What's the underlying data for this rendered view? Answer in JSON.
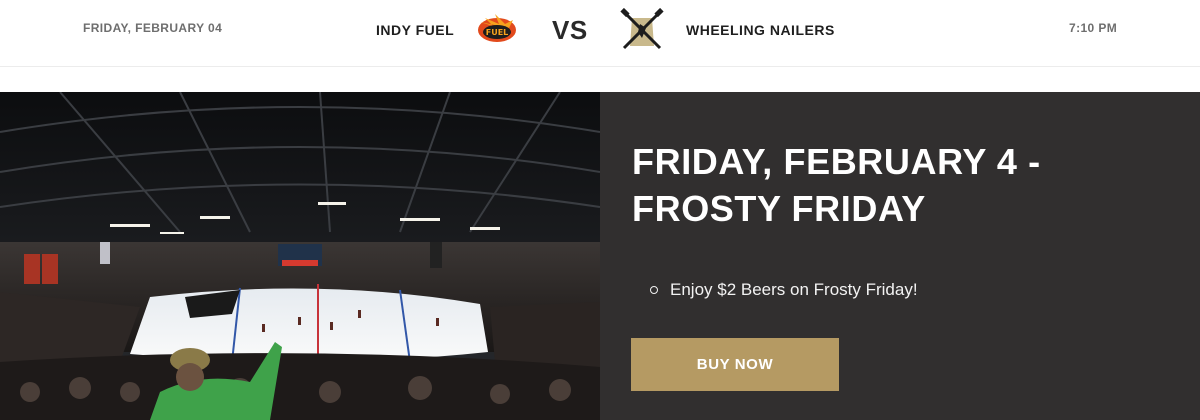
{
  "game": {
    "date": "FRIDAY, FEBRUARY 04",
    "home_team": "INDY FUEL",
    "home_logo_icon": "indy-fuel-logo-icon",
    "vs_label": "VS",
    "away_team": "WHEELING NAILERS",
    "away_logo_icon": "wheeling-nailers-logo-icon",
    "time": "7:10 PM"
  },
  "hero": {
    "photo": "arena-crowd-photo",
    "title": "FRIDAY, FEBRUARY 4 - FROSTY FRIDAY",
    "promos": [
      "Enjoy $2 Beers on Frosty Friday!"
    ],
    "buy_button_label": "BUY NOW"
  },
  "colors": {
    "panel_bg": "#312f2f",
    "accent_gold": "#b59a63",
    "fuel_orange": "#e24a1c"
  }
}
